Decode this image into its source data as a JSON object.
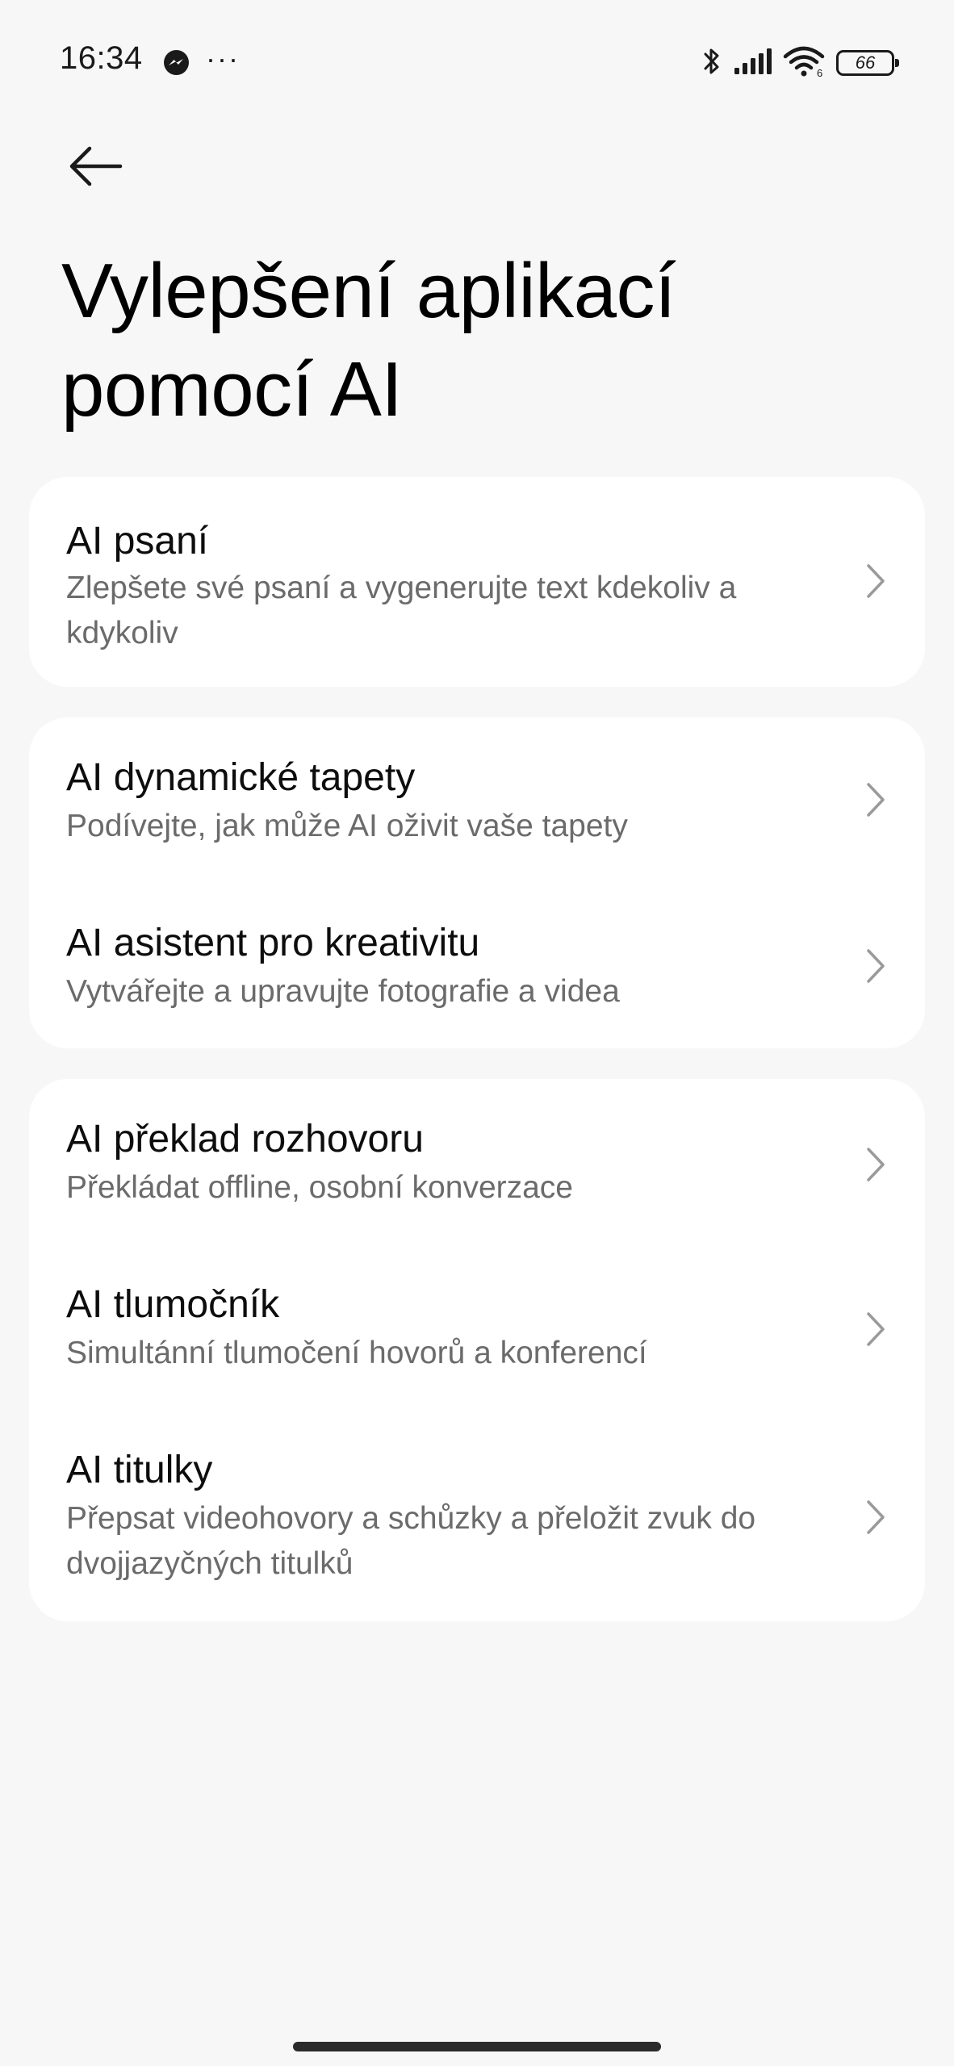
{
  "status_bar": {
    "time": "16:34",
    "more": "···",
    "battery_level": "66",
    "icons": [
      "messenger-icon",
      "bluetooth-icon",
      "signal-icon",
      "wifi-icon",
      "battery-icon"
    ]
  },
  "header": {
    "title": "Vylepšení aplikací pomocí AI"
  },
  "cards": [
    {
      "items": [
        {
          "title": "AI psaní",
          "subtitle": "Zlepšete své psaní a vygenerujte text kdekoliv a kdykoliv"
        }
      ]
    },
    {
      "items": [
        {
          "title": "AI dynamické tapety",
          "subtitle": "Podívejte, jak může AI oživit vaše tapety"
        },
        {
          "title": "AI asistent pro kreativitu",
          "subtitle": "Vytvářejte a upravujte fotografie a videa"
        }
      ]
    },
    {
      "items": [
        {
          "title": "AI překlad rozhovoru",
          "subtitle": "Překládat offline, osobní konverzace"
        },
        {
          "title": "AI tlumočník",
          "subtitle": "Simultánní tlumočení hovorů a konferencí"
        },
        {
          "title": "AI titulky",
          "subtitle": "Přepsat videohovory a schůzky a přeložit zvuk do dvojjazyčných titulků"
        }
      ]
    }
  ],
  "colors": {
    "background": "#f7f7f7",
    "card": "#ffffff",
    "title_text": "#0d0d0d",
    "subtitle_text": "#6b6b6b",
    "chevron": "#9a9a9a"
  }
}
